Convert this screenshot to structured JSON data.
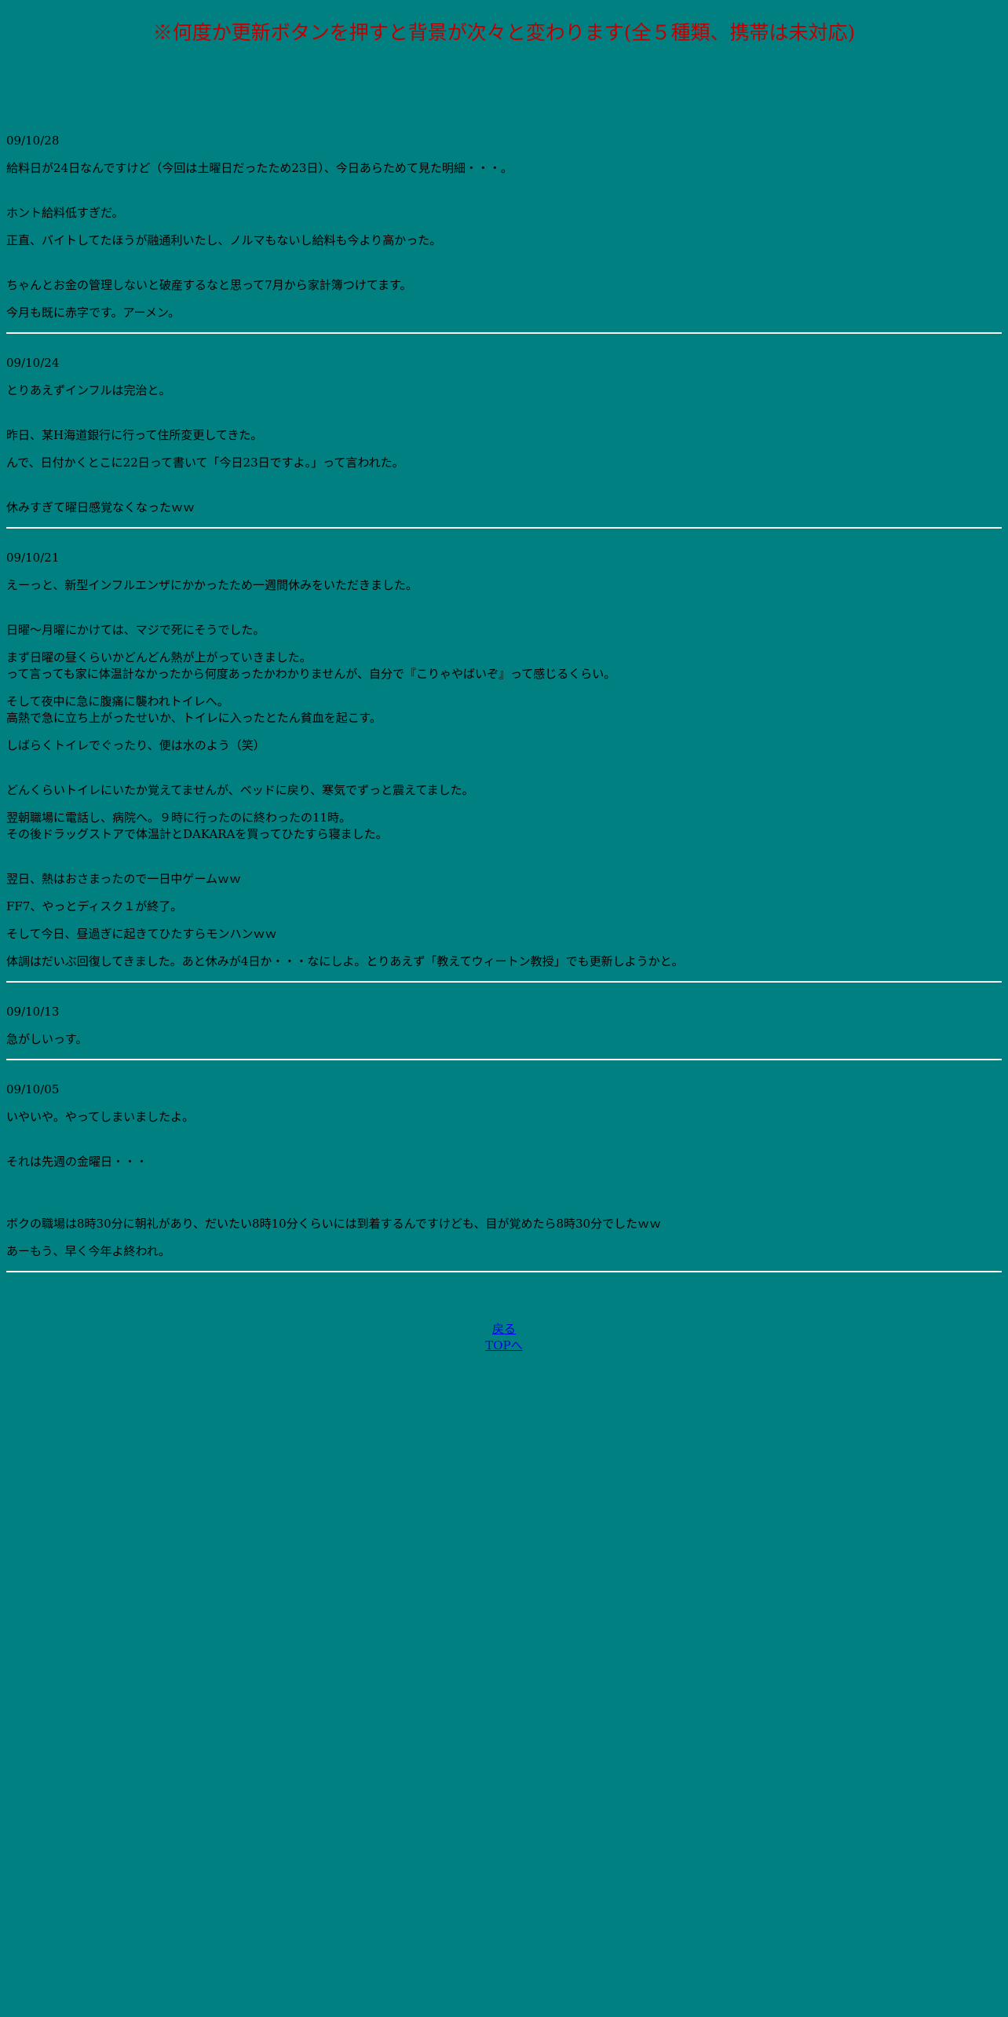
{
  "header": {
    "notice": "※何度か更新ボタンを押すと背景が次々と変わります(全５種類、携帯は未対応)"
  },
  "entries": [
    {
      "date": "09/10/28",
      "paragraphs": [
        "給料日が24日なんですけど（今回は土曜日だったため23日）、今日あらためて見た明細・・・。",
        "ホント給料低すぎだ。",
        "正直、バイトしてたほうが融通利いたし、ノルマもないし給料も今より高かった。",
        "ちゃんとお金の管理しないと破産するなと思って7月から家計簿つけてます。",
        "今月も既に赤字です。アーメン。"
      ]
    },
    {
      "date": "09/10/24",
      "paragraphs": [
        "とりあえずインフルは完治と。",
        "昨日、某H海道銀行に行って住所変更してきた。",
        "んで、日付かくとこに22日って書いて「今日23日ですよ。」って言われた。",
        "休みすぎて曜日感覚なくなったｗｗ"
      ]
    },
    {
      "date": "09/10/21",
      "paragraphs": [
        "えーっと、新型インフルエンザにかかったため一週間休みをいただきました。",
        "日曜～月曜にかけては、マジで死にそうでした。",
        "まず日曜の昼くらいかどんどん熱が上がっていきました。\nって言っても家に体温計なかったから何度あったかわかりませんが、自分で『こりゃやばいぞ』って感じるくらい。",
        "そして夜中に急に腹痛に襲われトイレへ。\n高熱で急に立ち上がったせいか、トイレに入ったとたん貧血を起こす。",
        "しばらくトイレでぐったり、便は水のよう（笑）",
        "どんくらいトイレにいたか覚えてませんが、ベッドに戻り、寒気でずっと震えてました。",
        "翌朝職場に電話し、病院へ。９時に行ったのに終わったの11時。\nその後ドラッグストアで体温計とDAKARAを買ってひたすら寝ました。",
        "翌日、熱はおさまったので一日中ゲームｗｗ",
        "FF7、やっとディスク１が終了。",
        "そして今日、昼過ぎに起きてひたすらモンハンｗｗ",
        "体調はだいぶ回復してきました。あと休みが4日か・・・なにしよ。とりあえず「教えてウィートン教授」でも更新しようかと。"
      ]
    },
    {
      "date": "09/10/13",
      "paragraphs": [
        "急がしいっす。"
      ]
    },
    {
      "date": "09/10/05",
      "paragraphs": [
        "いやいや。やってしまいましたよ。",
        "それは先週の金曜日・・・",
        "ボクの職場は8時30分に朝礼があり、だいたい8時10分くらいには到着するんですけども、目が覚めたら8時30分でしたｗｗ",
        "あーもう、早く今年よ終われ。"
      ]
    }
  ],
  "nav": {
    "back_label": "戻る",
    "top_label": "TOPへ"
  },
  "colors": {
    "background": "#008080",
    "notice": "#c00000",
    "link": "#0000ee",
    "divider": "#ffffff"
  }
}
